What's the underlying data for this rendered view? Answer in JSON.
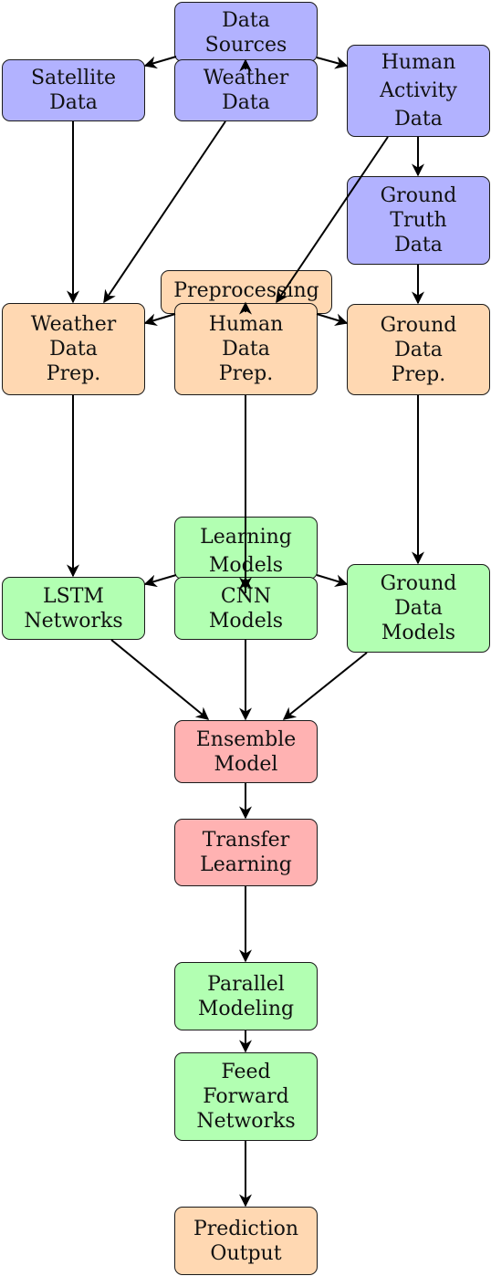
{
  "diagram": {
    "title": "",
    "colors": {
      "data_source": "#b2b2ff",
      "preprocessing": "#ffd8b2",
      "model": "#b2ffb2",
      "ensemble": "#ffb2b2",
      "edge": "#000000"
    },
    "nodes": {
      "data_sources": {
        "label": "Data\nSources",
        "category": "data_source"
      },
      "satellite_data": {
        "label": "Satellite\nData",
        "category": "data_source"
      },
      "weather_data": {
        "label": "Weather\nData",
        "category": "data_source"
      },
      "human_activity_data": {
        "label": "Human\nActivity\nData",
        "category": "data_source"
      },
      "ground_truth_data": {
        "label": "Ground\nTruth\nData",
        "category": "data_source"
      },
      "preprocessing": {
        "label": "Preprocessing",
        "category": "preprocessing"
      },
      "weather_data_prep": {
        "label": "Weather\nData\nPrep.",
        "category": "preprocessing"
      },
      "human_data_prep": {
        "label": "Human\nData\nPrep.",
        "category": "preprocessing"
      },
      "ground_data_prep": {
        "label": "Ground\nData\nPrep.",
        "category": "preprocessing"
      },
      "learning_models": {
        "label": "Learning\nModels",
        "category": "model"
      },
      "lstm_networks": {
        "label": "LSTM\nNetworks",
        "category": "model"
      },
      "cnn_models": {
        "label": "CNN\nModels",
        "category": "model"
      },
      "ground_data_models": {
        "label": "Ground\nData\nModels",
        "category": "model"
      },
      "ensemble_model": {
        "label": "Ensemble\nModel",
        "category": "ensemble"
      },
      "transfer_learning": {
        "label": "Transfer\nLearning",
        "category": "ensemble"
      },
      "parallel_modeling": {
        "label": "Parallel\nModeling",
        "category": "model"
      },
      "feed_forward_networks": {
        "label": "Feed\nForward\nNetworks",
        "category": "model"
      },
      "prediction_output": {
        "label": "Prediction\nOutput",
        "category": "preprocessing"
      }
    },
    "edges": [
      {
        "from": "data_sources",
        "to": "satellite_data"
      },
      {
        "from": "data_sources",
        "to": "weather_data"
      },
      {
        "from": "data_sources",
        "to": "human_activity_data"
      },
      {
        "from": "satellite_data",
        "to": "weather_data_prep"
      },
      {
        "from": "weather_data",
        "to": "weather_data_prep"
      },
      {
        "from": "human_activity_data",
        "to": "ground_truth_data"
      },
      {
        "from": "human_activity_data",
        "to": "human_data_prep"
      },
      {
        "from": "ground_truth_data",
        "to": "ground_data_prep"
      },
      {
        "from": "preprocessing",
        "to": "weather_data_prep"
      },
      {
        "from": "preprocessing",
        "to": "human_data_prep"
      },
      {
        "from": "preprocessing",
        "to": "ground_data_prep"
      },
      {
        "from": "weather_data_prep",
        "to": "lstm_networks"
      },
      {
        "from": "human_data_prep",
        "to": "cnn_models"
      },
      {
        "from": "ground_data_prep",
        "to": "ground_data_models"
      },
      {
        "from": "learning_models",
        "to": "lstm_networks"
      },
      {
        "from": "learning_models",
        "to": "cnn_models"
      },
      {
        "from": "learning_models",
        "to": "ground_data_models"
      },
      {
        "from": "lstm_networks",
        "to": "ensemble_model"
      },
      {
        "from": "cnn_models",
        "to": "ensemble_model"
      },
      {
        "from": "ground_data_models",
        "to": "ensemble_model"
      },
      {
        "from": "ensemble_model",
        "to": "transfer_learning"
      },
      {
        "from": "transfer_learning",
        "to": "parallel_modeling"
      },
      {
        "from": "parallel_modeling",
        "to": "feed_forward_networks"
      },
      {
        "from": "feed_forward_networks",
        "to": "prediction_output"
      }
    ]
  }
}
